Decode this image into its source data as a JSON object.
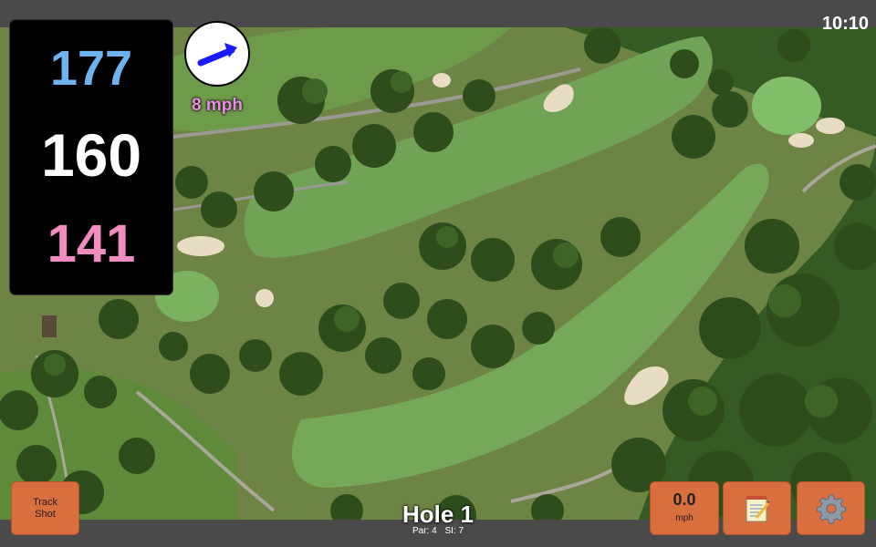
{
  "status": {
    "time": "10:10"
  },
  "distances": {
    "back": "177",
    "center": "160",
    "front": "141"
  },
  "wind": {
    "speed_label": "8 mph",
    "direction_icon": "wind-arrow-icon"
  },
  "hole": {
    "title": "Hole 1",
    "par_label": "Par: 4",
    "si_label": "SI: 7"
  },
  "buttons": {
    "track_shot_line1": "Track",
    "track_shot_line2": "Shot",
    "speed_value": "0.0",
    "speed_unit": "mph",
    "notes_icon": "notepad-icon",
    "settings_icon": "gear-icon"
  },
  "colors": {
    "back_distance": "#6fb2f0",
    "center_distance": "#ffffff",
    "front_distance": "#f28bc0",
    "button": "#d96e3e",
    "wind_text": "#e88ee0"
  }
}
